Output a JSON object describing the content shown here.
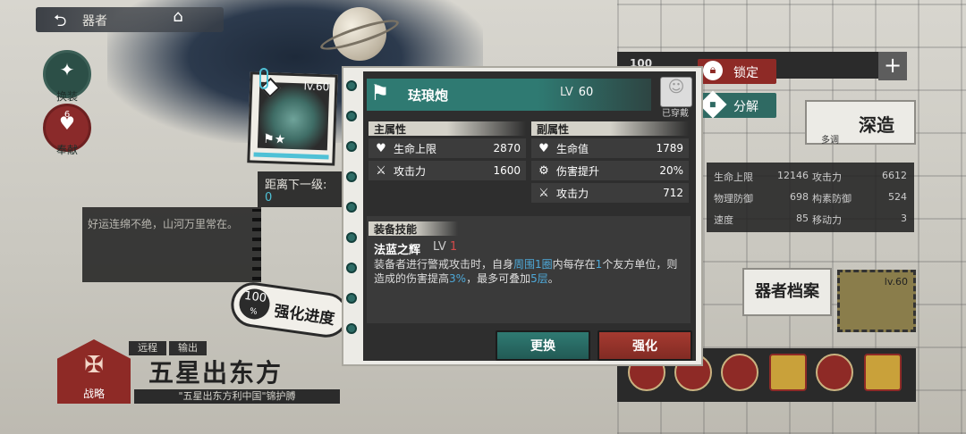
{
  "header": {
    "back_label": "器者"
  },
  "sidebar": {
    "swap_label": "换装",
    "bless_label": "奉献",
    "bless_count": "6"
  },
  "blessing_text": "好运连绵不绝，山河万里常在。",
  "next_level": {
    "label": "距离下一级:",
    "value": "0"
  },
  "progress": {
    "percent": "100",
    "unit": "%",
    "label": "强化进度"
  },
  "strategy_label": "战略",
  "tags": [
    "远程",
    "输出"
  ],
  "item_title": "五星出东方",
  "item_subtitle": "\"五星出东方利中国\"锦护膊",
  "right": {
    "lock_label": "锁定",
    "decompose_label": "分解",
    "strip_value": "100",
    "deep_label": "深造",
    "deep_sub": "多调",
    "stats": [
      {
        "name": "生命上限",
        "value": "12146"
      },
      {
        "name": "攻击力",
        "value": "6612"
      },
      {
        "name": "物理防御",
        "value": "698"
      },
      {
        "name": "构素防御",
        "value": "524"
      },
      {
        "name": "速度",
        "value": "85"
      },
      {
        "name": "移动力",
        "value": "3"
      }
    ],
    "archive_label": "器者档案",
    "thumb_level": "lv.60"
  },
  "equip": {
    "name": "珐琅炮",
    "level_prefix": "LV",
    "level": "60",
    "equipped_label": "已穿戴",
    "thumb_level": "lv.60",
    "main_title": "主属性",
    "sub_title": "副属性",
    "main_attrs": [
      {
        "icon": "heart-icon",
        "name": "生命上限",
        "value": "2870"
      },
      {
        "icon": "swords-icon",
        "name": "攻击力",
        "value": "1600"
      }
    ],
    "sub_attrs": [
      {
        "icon": "heart-icon",
        "name": "生命值",
        "value": "1789"
      },
      {
        "icon": "gear-icon",
        "name": "伤害提升",
        "value": "20%"
      },
      {
        "icon": "swords-icon",
        "name": "攻击力",
        "value": "712"
      }
    ],
    "skill_title": "装备技能",
    "skill_name": "法蓝之辉",
    "skill_lv_prefix": "LV",
    "skill_lv": "1",
    "skill_desc": {
      "p1": "装备者进行警戒攻击时，自身",
      "h1": "周围1圈",
      "p2": "内每存在",
      "h2": "1",
      "p3": "个友方单位，则造成的伤害提高",
      "h3": "3%",
      "p4": "，最多可叠加",
      "h4": "5层",
      "p5": "。"
    },
    "swap_button": "更换",
    "upgrade_button": "强化"
  },
  "colors": {
    "teal": "#2f7a72",
    "red": "#a53a30",
    "highlight": "#4ea9d9",
    "level_red": "#d44a4a"
  }
}
